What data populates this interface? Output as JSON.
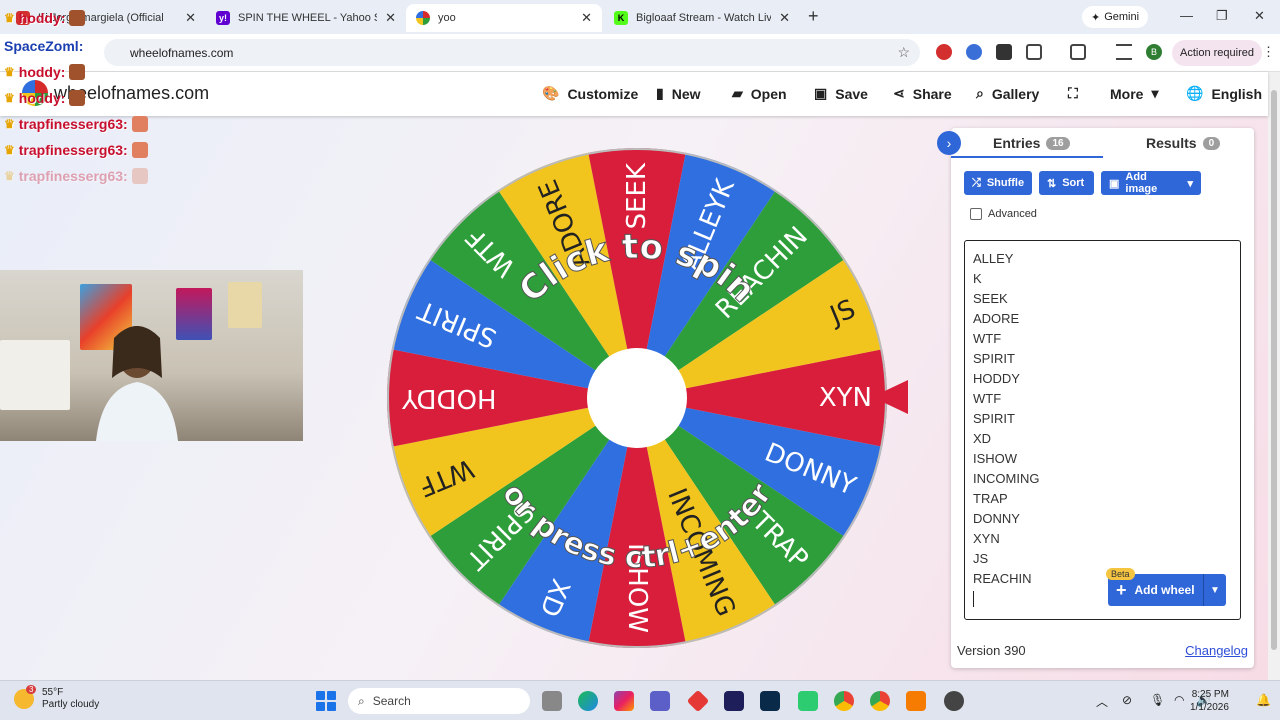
{
  "browser": {
    "tabs": [
      {
        "title": "Ki Jorge margiela (Official",
        "active": false
      },
      {
        "title": "SPIN THE WHEEL - Yahoo Sear",
        "active": false
      },
      {
        "title": "yoo",
        "active": true
      },
      {
        "title": "Bigloaaf Stream - Watch Live o",
        "active": false
      }
    ],
    "gemini_label": "Gemini",
    "url": "wheelofnames.com",
    "action_required": "Action required",
    "profile_initial": "B"
  },
  "site": {
    "brand": "wheelofnames.com",
    "nav": [
      {
        "label": "Customize",
        "icon": "palette-icon"
      },
      {
        "label": "New",
        "icon": "file-icon"
      },
      {
        "label": "Open",
        "icon": "folder-icon"
      },
      {
        "label": "Save",
        "icon": "save-icon"
      },
      {
        "label": "Share",
        "icon": "share-icon"
      },
      {
        "label": "Gallery",
        "icon": "search-icon"
      },
      {
        "label": "",
        "icon": "fullscreen-icon"
      },
      {
        "label": "More",
        "icon": "chevron-down-icon"
      },
      {
        "label": "English",
        "icon": "globe-icon"
      }
    ]
  },
  "stream_overlay": {
    "chat": [
      {
        "user": "hoddy:"
      },
      {
        "user": "SpaceZoml:"
      },
      {
        "user": "hoddy:"
      },
      {
        "user": "hoddy:"
      },
      {
        "user": "trapfinesserg63:"
      },
      {
        "user": "trapfinesserg63:"
      },
      {
        "user": "trapfinesserg63:"
      }
    ]
  },
  "wheel": {
    "top_text": "Click to spin",
    "bottom_text": "or press ctrl+enter",
    "slices": [
      {
        "label": "XYN",
        "color": "#d81e3a"
      },
      {
        "label": "DONNY",
        "color": "#2f6fe0"
      },
      {
        "label": "TRAP",
        "color": "#2e9e3a"
      },
      {
        "label": "INCOMING",
        "color": "#f2c51e"
      },
      {
        "label": "ISHOW",
        "color": "#d81e3a"
      },
      {
        "label": "XD",
        "color": "#2f6fe0"
      },
      {
        "label": "SPIRIT",
        "color": "#2e9e3a"
      },
      {
        "label": "WTF",
        "color": "#f2c51e"
      },
      {
        "label": "HODDY",
        "color": "#d81e3a"
      },
      {
        "label": "SPIRIT",
        "color": "#2f6fe0"
      },
      {
        "label": "WTF",
        "color": "#2e9e3a"
      },
      {
        "label": "ADORE",
        "color": "#f2c51e"
      },
      {
        "label": "SEEK",
        "color": "#d81e3a"
      },
      {
        "label": "ALLEYK",
        "color": "#2f6fe0"
      },
      {
        "label": "REACHIN",
        "color": "#2e9e3a"
      },
      {
        "label": "JS",
        "color": "#f2c51e"
      }
    ]
  },
  "panel": {
    "entries_tab": "Entries",
    "entries_count": "16",
    "results_tab": "Results",
    "results_count": "0",
    "shuffle": "Shuffle",
    "sort": "Sort",
    "add_image": "Add image",
    "advanced": "Advanced",
    "entries": [
      "ALLEY",
      "K",
      "SEEK",
      "ADORE",
      "WTF",
      "SPIRIT",
      "HODDY",
      "WTF",
      "SPIRIT",
      "XD",
      "ISHOW",
      "INCOMING",
      "TRAP",
      "DONNY",
      "XYN",
      "JS",
      "REACHIN"
    ],
    "beta": "Beta",
    "add_wheel": "Add wheel",
    "version": "Version 390",
    "changelog": "Changelog"
  },
  "taskbar": {
    "temp": "55°F",
    "condition": "Partly cloudy",
    "weather_badge": "3",
    "search": "Search",
    "time": "8:25 PM",
    "date": "1/1/2026"
  }
}
